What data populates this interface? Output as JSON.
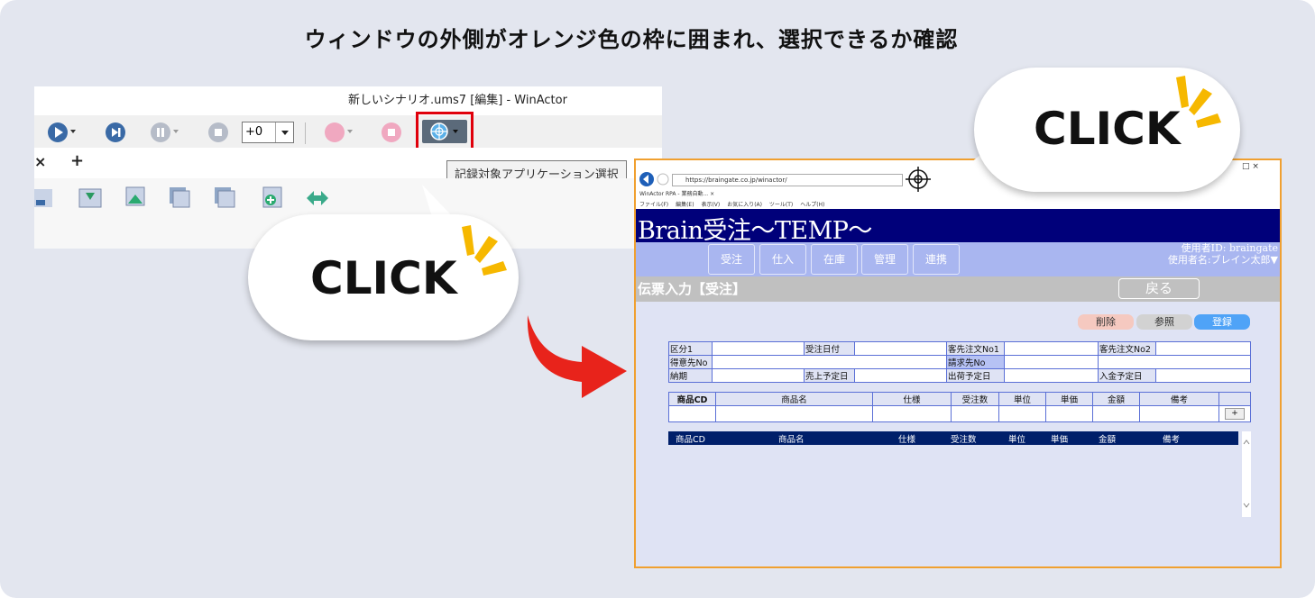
{
  "headline": "ウィンドウの外側がオレンジ色の枠に囲まれ、選択できるか確認",
  "winactor": {
    "title": "新しいシナリオ.ums7 [編集] - WinActor",
    "speed_value": "+0",
    "tooltip": "記録対象アプリケーション選択",
    "tab_close": "×",
    "tab_add": "+"
  },
  "callouts": {
    "left": "CLICK",
    "right": "CLICK"
  },
  "browser": {
    "url": "https://braingate.co.jp/winactor/",
    "tab": "WinActor  RPA - 業務自動...  ×",
    "menu": [
      "ファイル(F)",
      "編集(E)",
      "表示(V)",
      "お気に入り(A)",
      "ツール(T)",
      "ヘルプ(H)"
    ],
    "win_controls": "□  ×",
    "app_title": "Brain受注～TEMP～",
    "nav": [
      "受注",
      "仕入",
      "在庫",
      "管理",
      "連携"
    ],
    "user_id": "使用者ID: braingate",
    "user_name": "使用者名:ブレイン太郎▼",
    "page_title": "伝票入力【受注】",
    "back": "戻る",
    "actions": {
      "delete": "削除",
      "reference": "参照",
      "register": "登録"
    },
    "form": {
      "kubun": "区分1",
      "order_date": "受注日付",
      "cust_order1": "客先注文No1",
      "cust_order2": "客先注文No2",
      "customer_no": "得意先No",
      "billing_no": "請求先No",
      "due": "納期",
      "sales_date": "売上予定日",
      "ship_date": "出荷予定日",
      "payment_date": "入金予定日"
    },
    "columns": [
      "商品CD",
      "商品名",
      "仕様",
      "受注数",
      "単位",
      "単価",
      "金額",
      "備考"
    ],
    "add_row": "+"
  },
  "colors": {
    "background": "#e3e6ef",
    "highlight_red": "#e0000b",
    "orange_frame": "#f0a030",
    "header_navy": "#00007a",
    "nav_blue": "#a9b6f0",
    "register_blue": "#4fa3f7",
    "delete_pink": "#f5c9c0",
    "accent_yellow": "#f6b800",
    "arrow_red": "#e8231b"
  },
  "icons": [
    "play-icon",
    "step-icon",
    "pause-icon",
    "stop-icon",
    "record-icon",
    "record-stop-icon",
    "target-select-icon",
    "mouse-cursor-icon"
  ]
}
